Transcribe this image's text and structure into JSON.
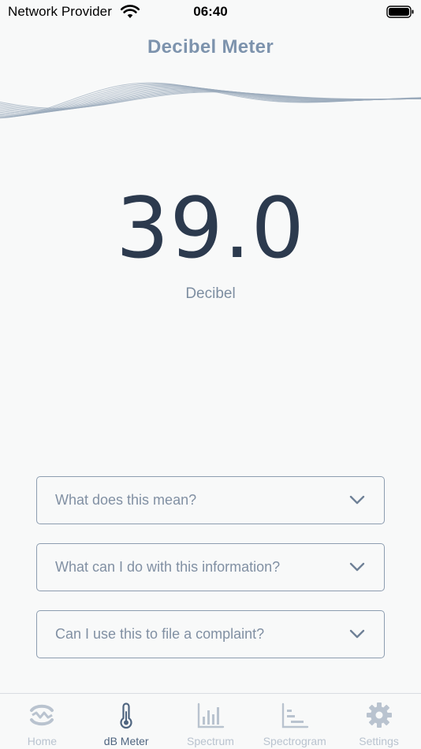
{
  "status_bar": {
    "carrier": "Network Provider",
    "time": "06:40"
  },
  "header": {
    "title": "Decibel Meter"
  },
  "reading": {
    "value": "39.0",
    "unit": "Decibel"
  },
  "faq": [
    {
      "question": "What does this mean?"
    },
    {
      "question": "What can I do with this information?"
    },
    {
      "question": "Can I use this to file a complaint?"
    }
  ],
  "tab_bar": {
    "active_index": 1,
    "tabs": [
      {
        "label": "Home",
        "icon": "home-logo-icon"
      },
      {
        "label": "dB Meter",
        "icon": "thermometer-icon"
      },
      {
        "label": "Spectrum",
        "icon": "bar-chart-icon"
      },
      {
        "label": "Spectrogram",
        "icon": "spectrogram-icon"
      },
      {
        "label": "Settings",
        "icon": "gear-icon"
      }
    ]
  },
  "colors": {
    "title": "#7d93ad",
    "reading": "#2c3a4e",
    "border": "#8d9db0",
    "tab_active": "#4f6580",
    "tab_inactive": "#b9c3cf"
  }
}
